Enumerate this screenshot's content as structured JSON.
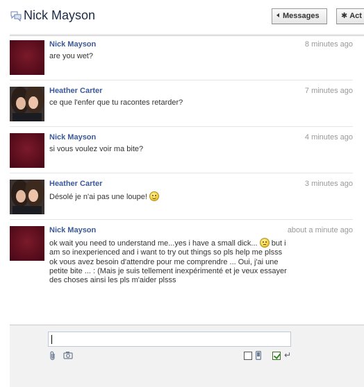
{
  "header": {
    "title": "Nick Mayson",
    "title_icon": "chat-bubbles-icon",
    "messages_button": "Messages",
    "actions_button": "Act"
  },
  "messages": [
    {
      "author": "Nick Mayson",
      "time": "8 minutes ago",
      "avatar": "dark-red-profile-picture",
      "lines": [
        "are you wet?"
      ]
    },
    {
      "author": "Heather Carter",
      "time": "7 minutes ago",
      "avatar": "two-girls-selfie-photo",
      "lines": [
        "ce que l'enfer que tu racontes retarder?"
      ]
    },
    {
      "author": "Nick Mayson",
      "time": "4 minutes ago",
      "avatar": "dark-red-profile-picture",
      "lines": [
        "si vous voulez voir ma bite?"
      ]
    },
    {
      "author": "Heather Carter",
      "time": "3 minutes ago",
      "avatar": "two-girls-selfie-photo",
      "line_before_emoji": "Désolé je n'ai pas une loupe!",
      "emoji": "smile-emoticon"
    },
    {
      "author": "Nick Mayson",
      "time": "about a minute ago",
      "avatar": "dark-red-profile-picture",
      "p1_part1": "ok wait you need to understand me...yes i have a small dick...",
      "p1_emoji": "worried-emoticon",
      "p1_part2": "but i am so inexperienced and i want to try out things so pls help me plsss",
      "p2": "ok vous avez besoin d'attendre pour me comprendre ... Oui, j'ai une petite bite ... : (Mais je suis tellement inexpérimenté et je veux essayer des choses ainsi les pls m'aider plsss"
    }
  ],
  "composer": {
    "value": "",
    "tools": [
      "paperclip-icon",
      "camera-icon",
      "checkbox-empty",
      "phone-icon",
      "checkbox-checked",
      "enter-return-icon"
    ]
  },
  "colors": {
    "author_link": "#3b5998",
    "timestamp": "#999999",
    "composer_bg": "#f2f2f2"
  }
}
